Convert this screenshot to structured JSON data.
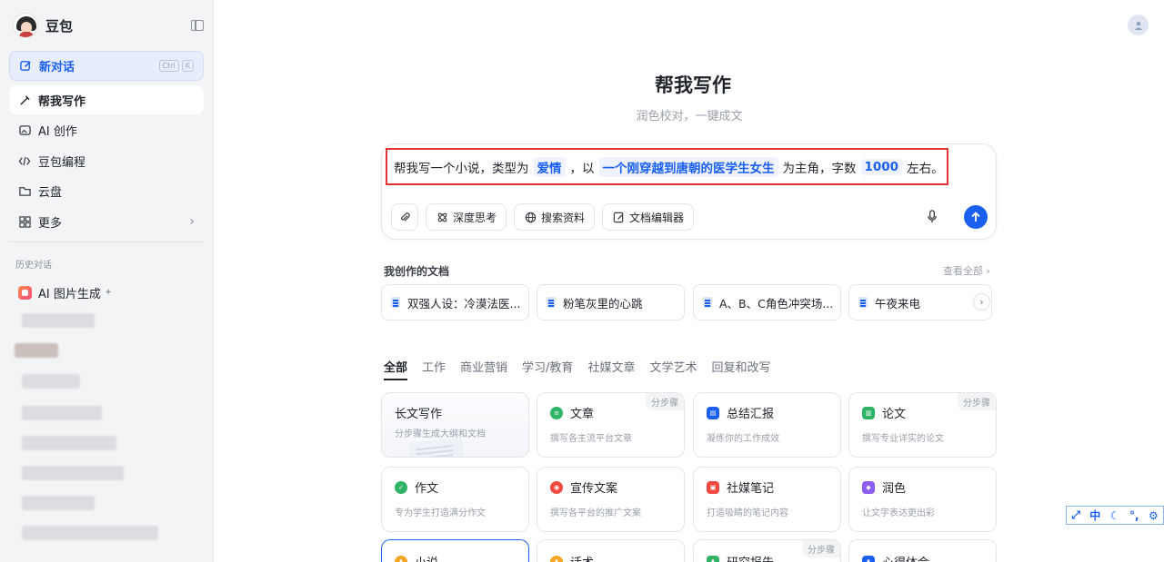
{
  "sidebar": {
    "brand": "豆包",
    "new_chat": {
      "label": "新对话",
      "keys": [
        "Ctrl",
        "K"
      ]
    },
    "nav": [
      {
        "id": "write",
        "label": "帮我写作",
        "icon": "pen-icon",
        "active": true
      },
      {
        "id": "ai-create",
        "label": "AI 创作",
        "icon": "image-icon"
      },
      {
        "id": "code",
        "label": "豆包编程",
        "icon": "code-icon"
      },
      {
        "id": "cloud",
        "label": "云盘",
        "icon": "folder-icon"
      },
      {
        "id": "more",
        "label": "更多",
        "icon": "grid-icon"
      }
    ],
    "history_title": "历史对话",
    "history_pinned": "AI 图片生成"
  },
  "main": {
    "title": "帮我写作",
    "subtitle": "润色校对，一键成文",
    "prompt": {
      "t1": "帮我写一个小说，类型为",
      "s1": "爱情",
      "t2": "，以",
      "s2": "一个刚穿越到唐朝的医学生女生",
      "t3": "为主角，字数",
      "s3": "1000",
      "t4": "左右。"
    },
    "tools": {
      "deep_think": "深度思考",
      "search": "搜索资料",
      "doc_editor": "文档编辑器"
    },
    "docs": {
      "title": "我创作的文档",
      "view_all": "查看全部",
      "items": [
        "双强人设：冷漠法医...",
        "粉笔灰里的心跳",
        "A、B、C角色冲突场...",
        "午夜来电"
      ]
    },
    "categories": [
      "全部",
      "工作",
      "商业营销",
      "学习/教育",
      "社媒文章",
      "文学艺术",
      "回复和改写"
    ],
    "cards": [
      {
        "title": "长文写作",
        "desc": "分步骤生成大纲和文档"
      },
      {
        "title": "文章",
        "desc": "撰写各主流平台文章",
        "tag": "分步骤"
      },
      {
        "title": "总结汇报",
        "desc": "凝练你的工作成效"
      },
      {
        "title": "论文",
        "desc": "撰写专业详实的论文",
        "tag": "分步骤"
      },
      {
        "title": "作文",
        "desc": "专为学生打造满分作文"
      },
      {
        "title": "宣传文案",
        "desc": "撰写各平台的推广文案"
      },
      {
        "title": "社媒笔记",
        "desc": "打造吸睛的笔记内容"
      },
      {
        "title": "润色",
        "desc": "让文字表达更出彩"
      },
      {
        "title": "小说",
        "desc": ""
      },
      {
        "title": "话术",
        "desc": ""
      },
      {
        "title": "研究报告",
        "desc": "",
        "tag": "分步骤"
      },
      {
        "title": "心得体会",
        "desc": ""
      }
    ]
  },
  "float_toolbar": {
    "lang": "中"
  },
  "colors": {
    "accent": "#1a5ff0",
    "highlight_border": "#e23434",
    "sidebar_bg": "#f3f4f6"
  }
}
